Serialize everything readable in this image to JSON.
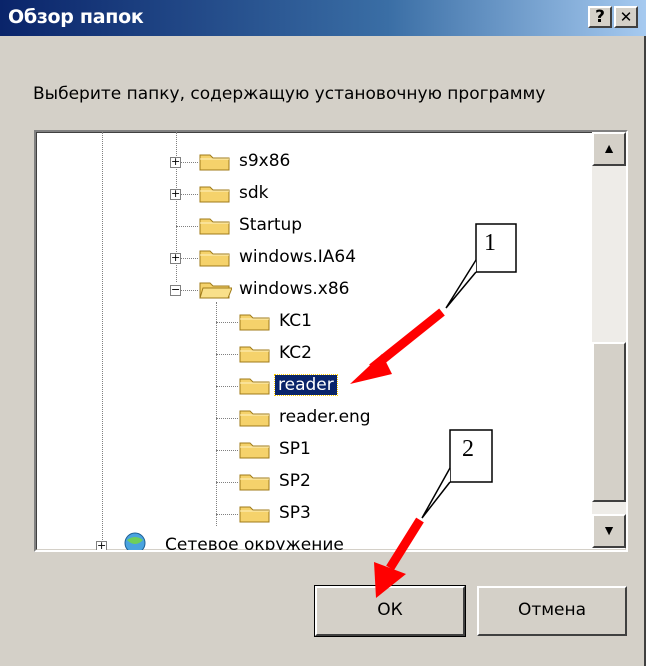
{
  "window": {
    "title": "Обзор папок",
    "help_label": "?",
    "close_label": "✕"
  },
  "prompt": "Выберите папку, содержащую установочную программу",
  "tree": {
    "items": [
      {
        "label": "s9x86",
        "expander": "+"
      },
      {
        "label": "sdk",
        "expander": "+"
      },
      {
        "label": "Startup",
        "expander": ""
      },
      {
        "label": "windows.IA64",
        "expander": "+"
      },
      {
        "label": "windows.x86",
        "expander": "−"
      },
      {
        "label": "KC1",
        "expander": ""
      },
      {
        "label": "KC2",
        "expander": ""
      },
      {
        "label": "reader",
        "expander": "",
        "selected": true
      },
      {
        "label": "reader.eng",
        "expander": ""
      },
      {
        "label": "SP1",
        "expander": ""
      },
      {
        "label": "SP2",
        "expander": ""
      },
      {
        "label": "SP3",
        "expander": ""
      },
      {
        "label": "Сетевое окружение",
        "expander": "+"
      }
    ]
  },
  "buttons": {
    "ok": "ОК",
    "cancel": "Отмена"
  },
  "callouts": {
    "one": "1",
    "two": "2"
  },
  "colors": {
    "selection": "#0a246a",
    "arrow": "#ff0000",
    "folder": "#f5d26b"
  },
  "icons": {
    "folder": "folder-icon",
    "network": "network-places-icon",
    "scroll_up": "▲",
    "scroll_down": "▼"
  }
}
